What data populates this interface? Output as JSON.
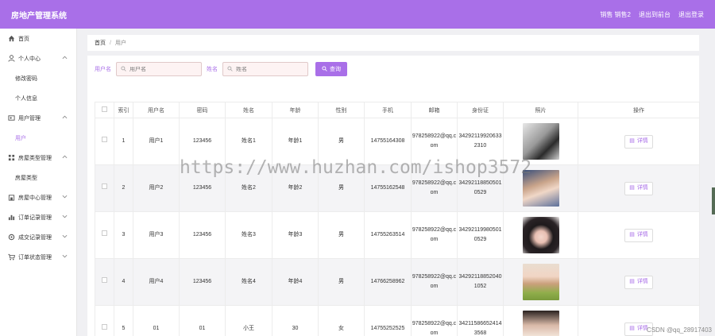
{
  "app": {
    "title": "房地产管理系统"
  },
  "header": {
    "user": "销售 销售2",
    "back_label": "退出到前台",
    "logout_label": "退出登录"
  },
  "sidebar": {
    "items": [
      {
        "label": "首页",
        "icon": "home-icon",
        "type": "top"
      },
      {
        "label": "个人中心",
        "icon": "user-icon",
        "type": "group",
        "expanded": true
      },
      {
        "label": "修改密码",
        "type": "sub"
      },
      {
        "label": "个人信息",
        "type": "sub"
      },
      {
        "label": "用户管理",
        "icon": "users-icon",
        "type": "group",
        "expanded": true
      },
      {
        "label": "用户",
        "type": "sub",
        "active": true
      },
      {
        "label": "房屋类型管理",
        "icon": "grid-icon",
        "type": "group",
        "expanded": true
      },
      {
        "label": "房屋类型",
        "type": "sub"
      },
      {
        "label": "房屋中心管理",
        "icon": "house-icon",
        "type": "group"
      },
      {
        "label": "订单记录管理",
        "icon": "bar-chart-icon",
        "type": "group"
      },
      {
        "label": "成交记录管理",
        "icon": "gear-icon",
        "type": "group"
      },
      {
        "label": "订单状态管理",
        "icon": "cart-icon",
        "type": "group"
      }
    ]
  },
  "breadcrumb": {
    "home": "首页",
    "sep": "/",
    "current": "用户"
  },
  "search": {
    "username_label": "用户名",
    "username_placeholder": "用户名",
    "name_label": "姓名",
    "name_placeholder": "姓名",
    "button": "查询"
  },
  "table": {
    "headers": [
      "",
      "索引",
      "用户名",
      "密码",
      "姓名",
      "年龄",
      "性别",
      "手机",
      "邮箱",
      "身份证",
      "照片",
      "操作"
    ],
    "detail_label": "详情",
    "rows": [
      {
        "index": "1",
        "username": "用户1",
        "password": "123456",
        "name": "姓名1",
        "age": "年龄1",
        "gender": "男",
        "phone": "14755164308",
        "email": "978258922@qq.com",
        "idcard": "342921199206332310",
        "photo": "grayscale-portrait"
      },
      {
        "index": "2",
        "username": "用户2",
        "password": "123456",
        "name": "姓名2",
        "age": "年龄2",
        "gender": "男",
        "phone": "14755162548",
        "email": "978258922@qq.com",
        "idcard": "342921188505010529",
        "photo": "young-man-portrait"
      },
      {
        "index": "3",
        "username": "用户3",
        "password": "123456",
        "name": "姓名3",
        "age": "年龄3",
        "gender": "男",
        "phone": "14755263514",
        "email": "978258922@qq.com",
        "idcard": "342921199805010529",
        "photo": "woman-portrait"
      },
      {
        "index": "4",
        "username": "用户4",
        "password": "123456",
        "name": "姓名4",
        "age": "年龄4",
        "gender": "男",
        "phone": "14766258962",
        "email": "978258922@qq.com",
        "idcard": "342921188520401052",
        "photo": "woman-green-portrait"
      },
      {
        "index": "5",
        "username": "01",
        "password": "01",
        "name": "小王",
        "age": "30",
        "gender": "女",
        "phone": "14755252525",
        "email": "978258922@qq.com",
        "idcard": "342115866524143568",
        "photo": "woman-dress-portrait"
      }
    ]
  },
  "watermark": "https://www.huzhan.com/ishop3572",
  "csdn_mark": "CSDN @qq_28917403"
}
